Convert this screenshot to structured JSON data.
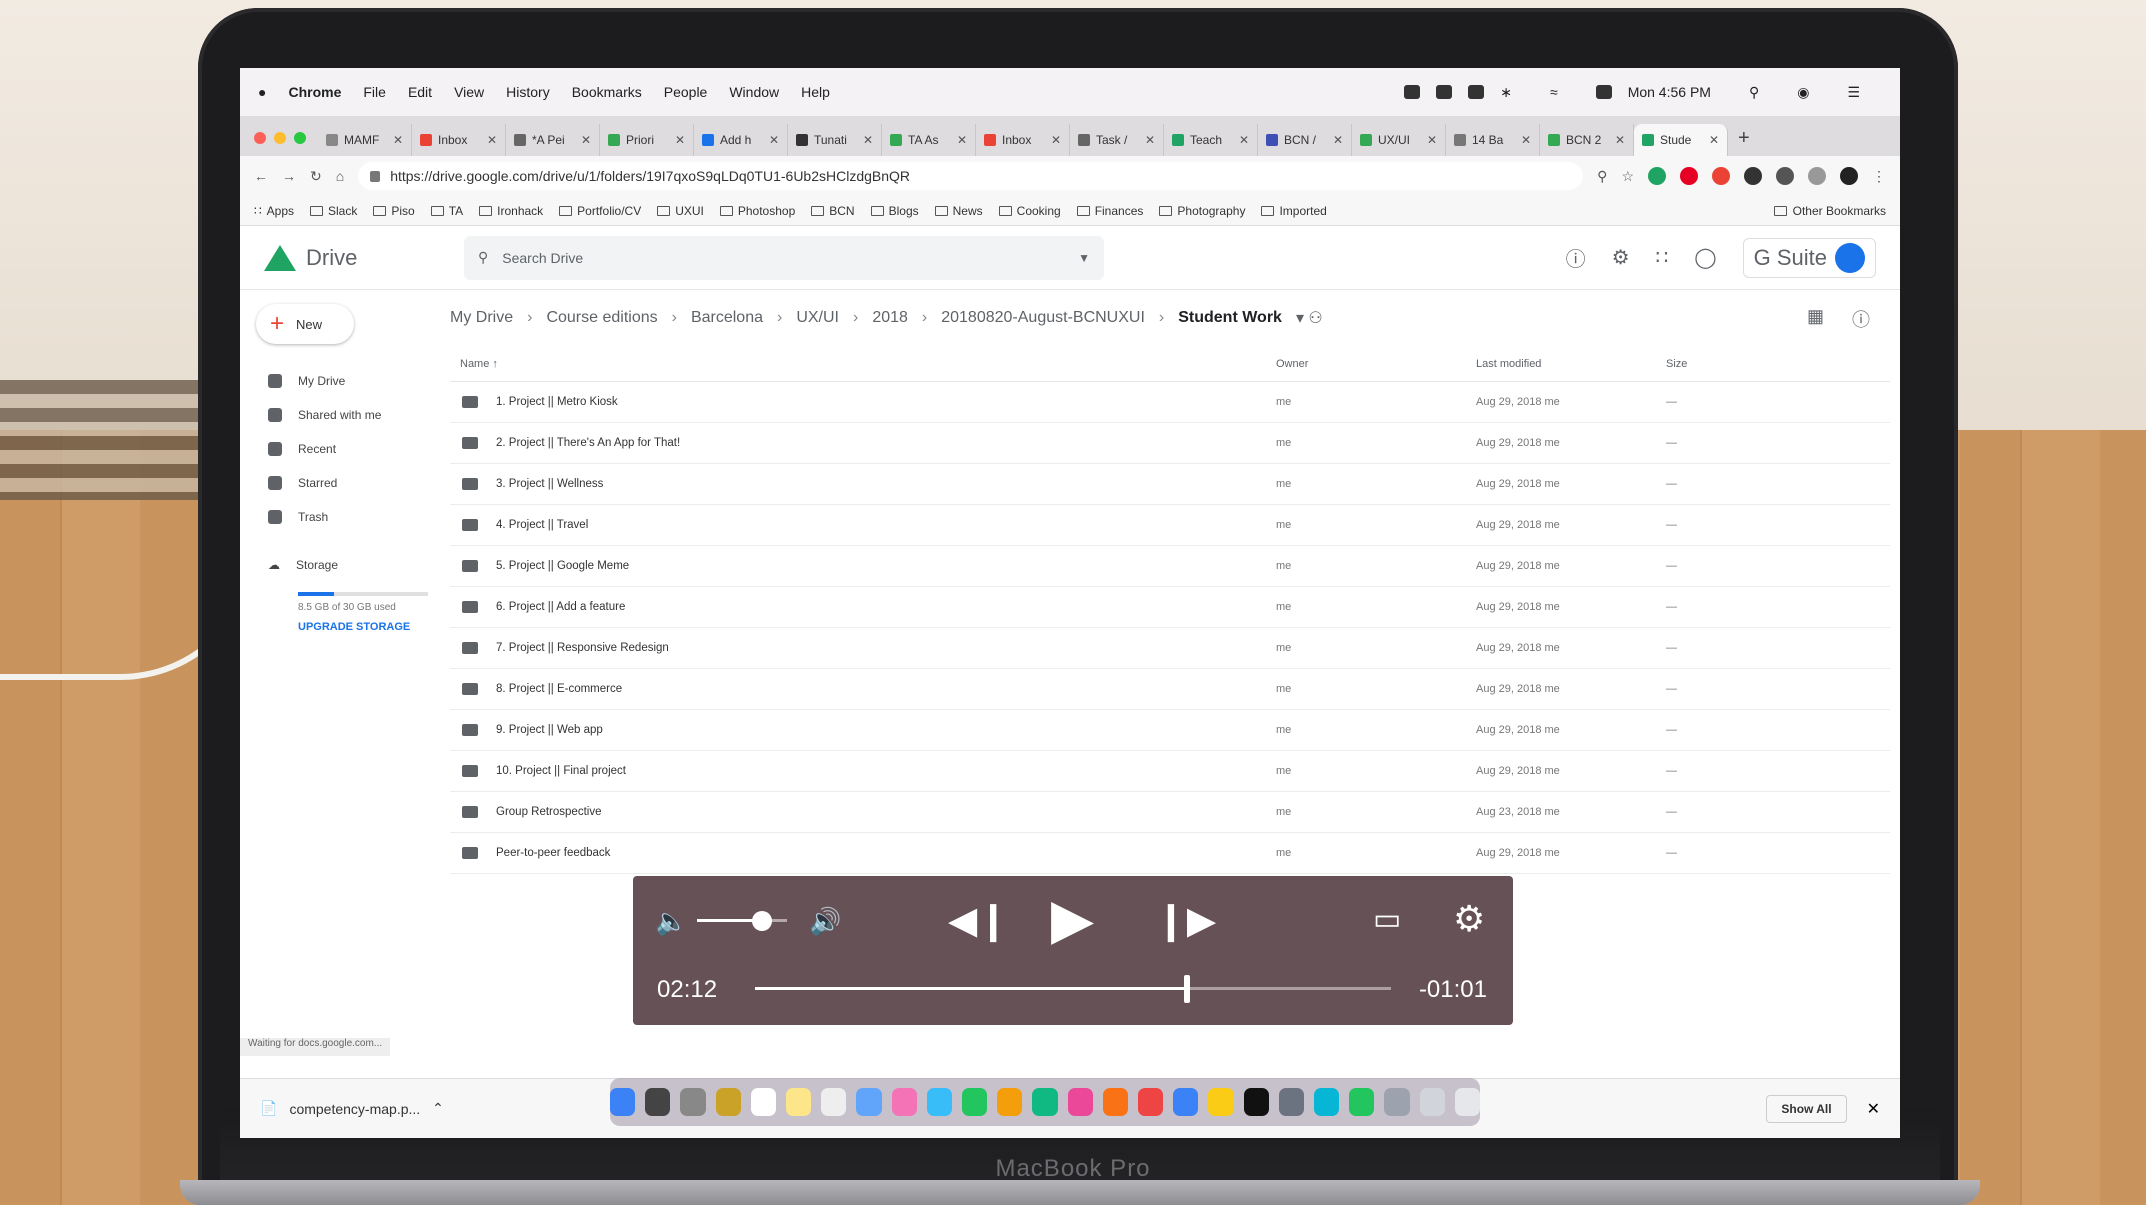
{
  "menubar": {
    "app": "Chrome",
    "items": [
      "File",
      "Edit",
      "View",
      "History",
      "Bookmarks",
      "People",
      "Window",
      "Help"
    ],
    "clock": "Mon 4:56 PM"
  },
  "tabs": [
    {
      "label": "MAMF",
      "color": "#888888"
    },
    {
      "label": "Inbox",
      "color": "#ea4335"
    },
    {
      "label": "*A Pei",
      "color": "#666666"
    },
    {
      "label": "Priori",
      "color": "#34a853"
    },
    {
      "label": "Add h",
      "color": "#1a73e8"
    },
    {
      "label": "Tunati",
      "color": "#333333"
    },
    {
      "label": "TA As",
      "color": "#34a853"
    },
    {
      "label": "Inbox",
      "color": "#ea4335"
    },
    {
      "label": "Task /",
      "color": "#666666"
    },
    {
      "label": "Teach",
      "color": "#1fa463"
    },
    {
      "label": "BCN /",
      "color": "#3f51b5"
    },
    {
      "label": "UX/UI",
      "color": "#34a853"
    },
    {
      "label": "14 Ba",
      "color": "#777777"
    },
    {
      "label": "BCN 2",
      "color": "#34a853"
    },
    {
      "label": "Stude",
      "color": "#1fa463",
      "active": true
    }
  ],
  "toolbar": {
    "url": "https://drive.google.com/drive/u/1/folders/19I7qxoS9qLDq0TU1-6Ub2sHClzdgBnQR"
  },
  "bookmarks": {
    "apps": "Apps",
    "items": [
      "Slack",
      "Piso",
      "TA",
      "Ironhack",
      "Portfolio/CV",
      "UXUI",
      "Photoshop",
      "BCN",
      "Blogs",
      "News",
      "Cooking",
      "Finances",
      "Photography",
      "Imported"
    ],
    "other": "Other Bookmarks"
  },
  "drive": {
    "title": "Drive",
    "search_placeholder": "Search Drive",
    "gsuite": "G Suite",
    "new_label": "New",
    "sidebar": [
      "My Drive",
      "Shared with me",
      "Recent",
      "Starred",
      "Trash"
    ],
    "storage_label": "Storage",
    "storage_used": "8.5 GB of 30 GB used",
    "storage_fraction": 0.28,
    "upgrade": "UPGRADE STORAGE",
    "breadcrumb": [
      "My Drive",
      "Course editions",
      "Barcelona",
      "UX/UI",
      "2018",
      "20180820-August-BCNUXUI",
      "Student Work"
    ],
    "columns": {
      "name": "Name",
      "owner": "Owner",
      "modified": "Last modified",
      "size": "Size"
    },
    "files": [
      {
        "name": "1. Project || Metro Kiosk",
        "owner": "me",
        "modified": "Aug 29, 2018 me",
        "size": "—"
      },
      {
        "name": "2. Project || There's An App for That!",
        "owner": "me",
        "modified": "Aug 29, 2018 me",
        "size": "—"
      },
      {
        "name": "3. Project || Wellness",
        "owner": "me",
        "modified": "Aug 29, 2018 me",
        "size": "—"
      },
      {
        "name": "4. Project || Travel",
        "owner": "me",
        "modified": "Aug 29, 2018 me",
        "size": "—"
      },
      {
        "name": "5. Project || Google Meme",
        "owner": "me",
        "modified": "Aug 29, 2018 me",
        "size": "—"
      },
      {
        "name": "6. Project || Add a feature",
        "owner": "me",
        "modified": "Aug 29, 2018 me",
        "size": "—"
      },
      {
        "name": "7. Project || Responsive Redesign",
        "owner": "me",
        "modified": "Aug 29, 2018 me",
        "size": "—"
      },
      {
        "name": "8. Project || E-commerce",
        "owner": "me",
        "modified": "Aug 29, 2018 me",
        "size": "—"
      },
      {
        "name": "9. Project || Web app",
        "owner": "me",
        "modified": "Aug 29, 2018 me",
        "size": "—"
      },
      {
        "name": "10. Project || Final project",
        "owner": "me",
        "modified": "Aug 29, 2018 me",
        "size": "—"
      },
      {
        "name": "Group Retrospective",
        "owner": "me",
        "modified": "Aug 23, 2018 me",
        "size": "—"
      },
      {
        "name": "Peer-to-peer feedback",
        "owner": "me",
        "modified": "Aug 29, 2018 me",
        "size": "—"
      }
    ],
    "status": "Waiting for docs.google.com...",
    "download": "competency-map.p...",
    "show_all": "Show All"
  },
  "player": {
    "current": "02:12",
    "remaining": "-01:01",
    "progress": 0.68,
    "volume": 0.72
  },
  "laptop_brand": "MacBook Pro"
}
